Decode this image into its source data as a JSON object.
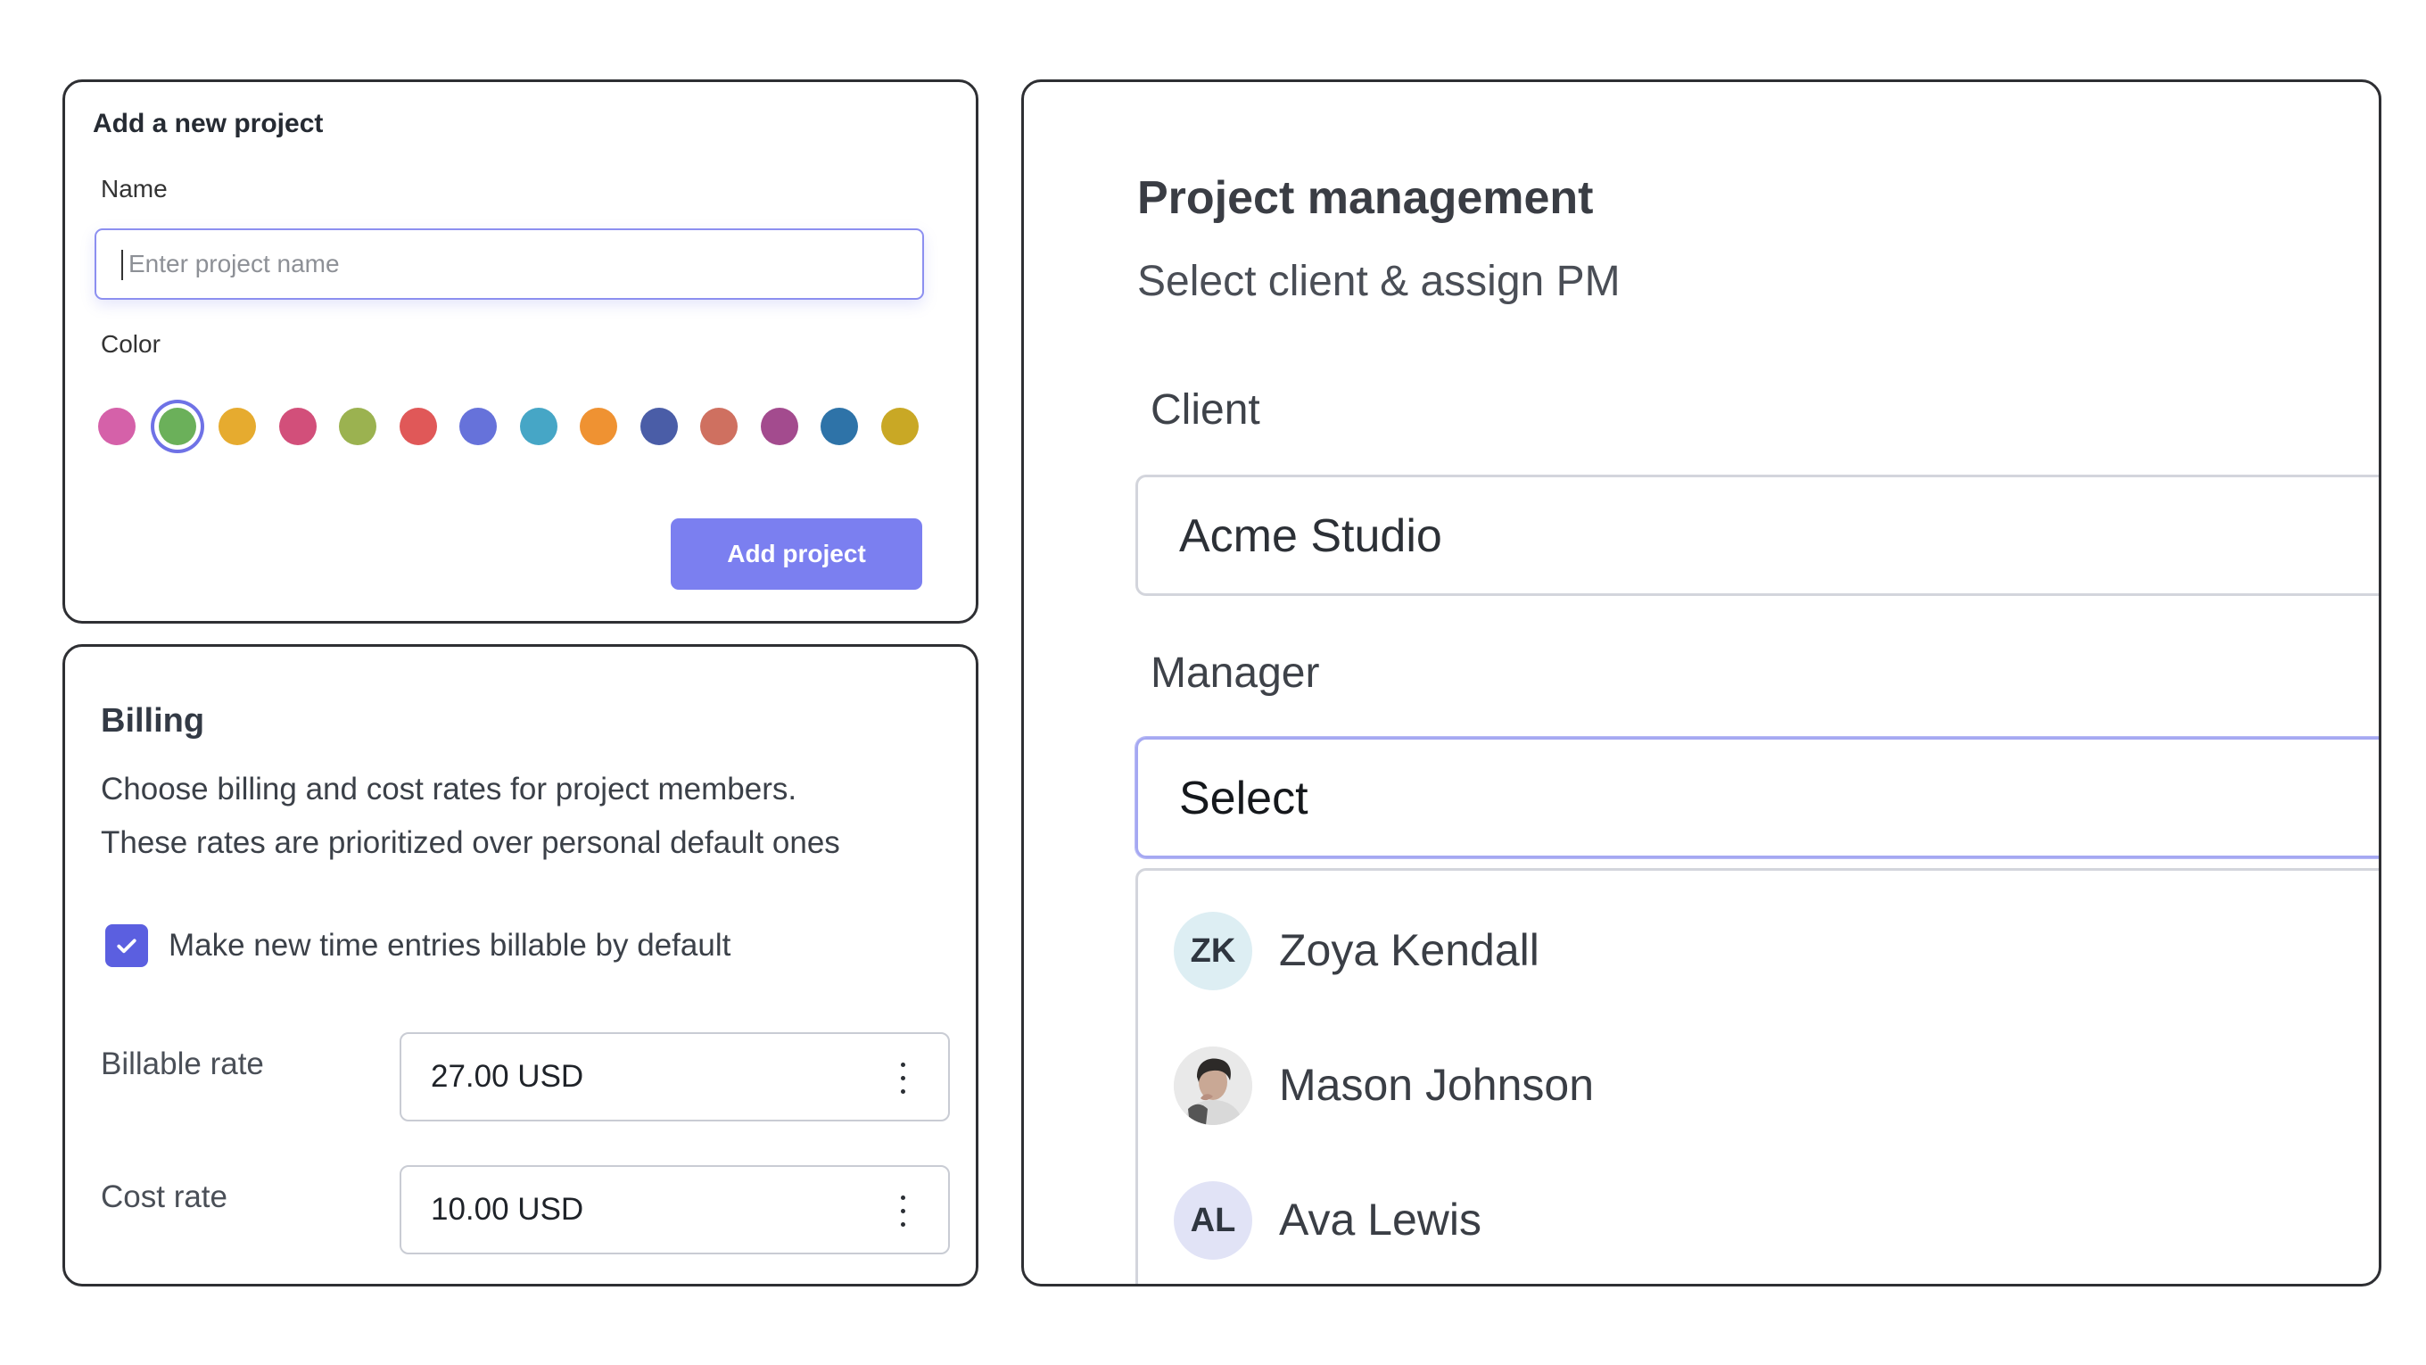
{
  "add_project": {
    "title": "Add a new project",
    "name_label": "Name",
    "name_placeholder": "Enter project name",
    "name_value": "",
    "color_label": "Color",
    "colors": [
      "#d561a9",
      "#6bb05a",
      "#e6ab2f",
      "#d24f7a",
      "#9bb250",
      "#e05858",
      "#6672da",
      "#46a6c6",
      "#ef9232",
      "#4a5da7",
      "#cf7060",
      "#a34b8e",
      "#2e73a8",
      "#c9a825"
    ],
    "selected_color_index": 1,
    "button_label": "Add project"
  },
  "billing": {
    "title": "Billing",
    "description_lines": [
      "Choose billing and cost rates for project members.",
      "These rates are prioritized over personal default ones"
    ],
    "checkbox_label": "Make new time entries billable by default",
    "checkbox_checked": true,
    "billable_rate_label": "Billable rate",
    "billable_rate_value": "27.00 USD",
    "cost_rate_label": "Cost rate",
    "cost_rate_value": "10.00 USD"
  },
  "project_management": {
    "title": "Project management",
    "subtitle": "Select client & assign PM",
    "client_label": "Client",
    "client_value": "Acme Studio",
    "manager_label": "Manager",
    "manager_value": "Select",
    "managers": [
      {
        "initials": "ZK",
        "name": "Zoya Kendall",
        "avatar": "initials"
      },
      {
        "initials": "",
        "name": "Mason Johnson",
        "avatar": "photo"
      },
      {
        "initials": "AL",
        "name": "Ava Lewis",
        "avatar": "initials"
      }
    ]
  }
}
